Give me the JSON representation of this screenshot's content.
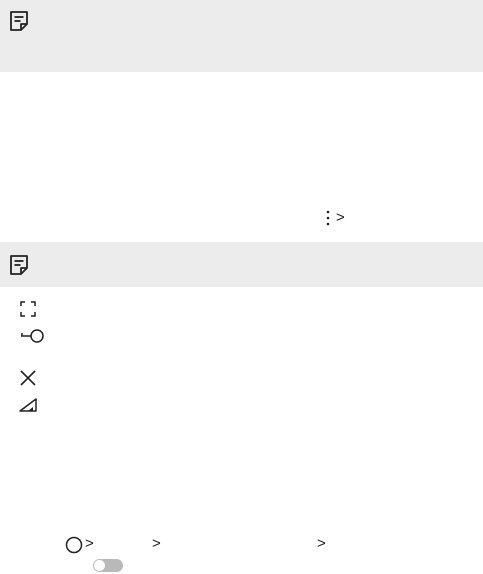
{
  "page": {
    "background": "#ffffff",
    "note_bar_color": "#ececec"
  },
  "icons": {
    "note": "note-memo-icon",
    "more": "more-vertical-icon",
    "chevron": "chevron-right-icon",
    "capture": "capture-area-icon",
    "key": "key-icon",
    "close": "close-x-icon",
    "signal": "signal-strength-icon",
    "home": "home-circle-icon"
  },
  "chevrons": {
    "menu_path": ">",
    "step1": ">",
    "step2": ">",
    "step3": ">"
  },
  "settings_toggle": {
    "state": "off",
    "color": "#b9b9b9"
  }
}
